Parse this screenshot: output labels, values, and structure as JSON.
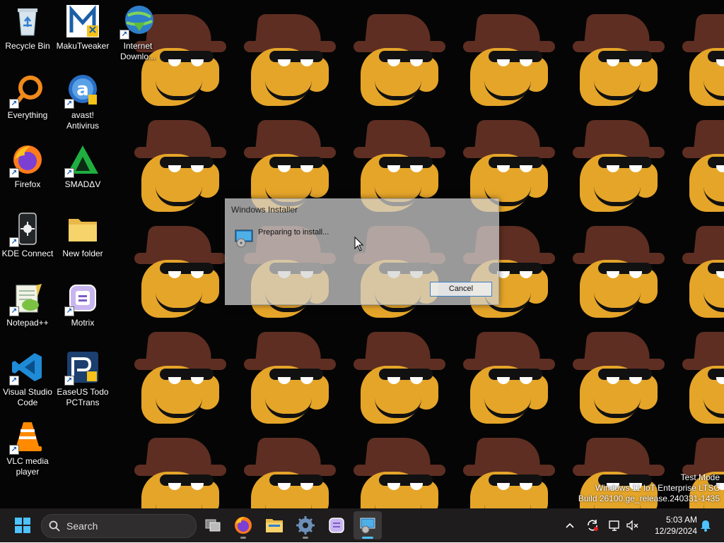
{
  "desktop_icons": [
    {
      "label": "Recycle Bin",
      "icon": "recycle-bin-icon"
    },
    {
      "label": "MakuTweaker",
      "icon": "makutweaker-icon"
    },
    {
      "label": "Internet Downlo...",
      "icon": "internet-download-manager-icon"
    },
    {
      "label": "Everything",
      "icon": "everything-search-icon"
    },
    {
      "label": "avast! Antivirus",
      "icon": "avast-icon"
    },
    {
      "label": "Firefox",
      "icon": "firefox-icon"
    },
    {
      "label": "SMADΔV",
      "icon": "smadav-icon"
    },
    {
      "label": "KDE Connect",
      "icon": "kde-connect-icon"
    },
    {
      "label": "New folder",
      "icon": "folder-icon"
    },
    {
      "label": "Notepad++",
      "icon": "notepad-plus-plus-icon"
    },
    {
      "label": "Motrix",
      "icon": "motrix-icon"
    },
    {
      "label": "Visual Studio Code",
      "icon": "vscode-icon"
    },
    {
      "label": "EaseUS Todo PCTrans",
      "icon": "easeus-pctrans-icon"
    },
    {
      "label": "VLC media player",
      "icon": "vlc-icon"
    }
  ],
  "dialog": {
    "title": "Windows Installer",
    "message": "Preparing to install...",
    "cancel_label": "Cancel"
  },
  "watermark": {
    "line1": "Test Mode",
    "line2": "Windows 11 IoT Enterprise LTSC",
    "line3": "Build 26100.ge_release.240331-1435"
  },
  "taskbar": {
    "search_placeholder": "Search",
    "apps": [
      "task-view-icon",
      "firefox-icon",
      "file-explorer-icon",
      "settings-icon",
      "motrix-icon",
      "windows-installer-icon"
    ],
    "time": "5:03 AM",
    "date": "12/29/2024"
  },
  "colors": {
    "wallpaper_bg": "#050505",
    "hat": "#5e2e22",
    "face": "#e5a529",
    "taskbar": "#1e1c1c",
    "accent": "#4cc2ff"
  }
}
